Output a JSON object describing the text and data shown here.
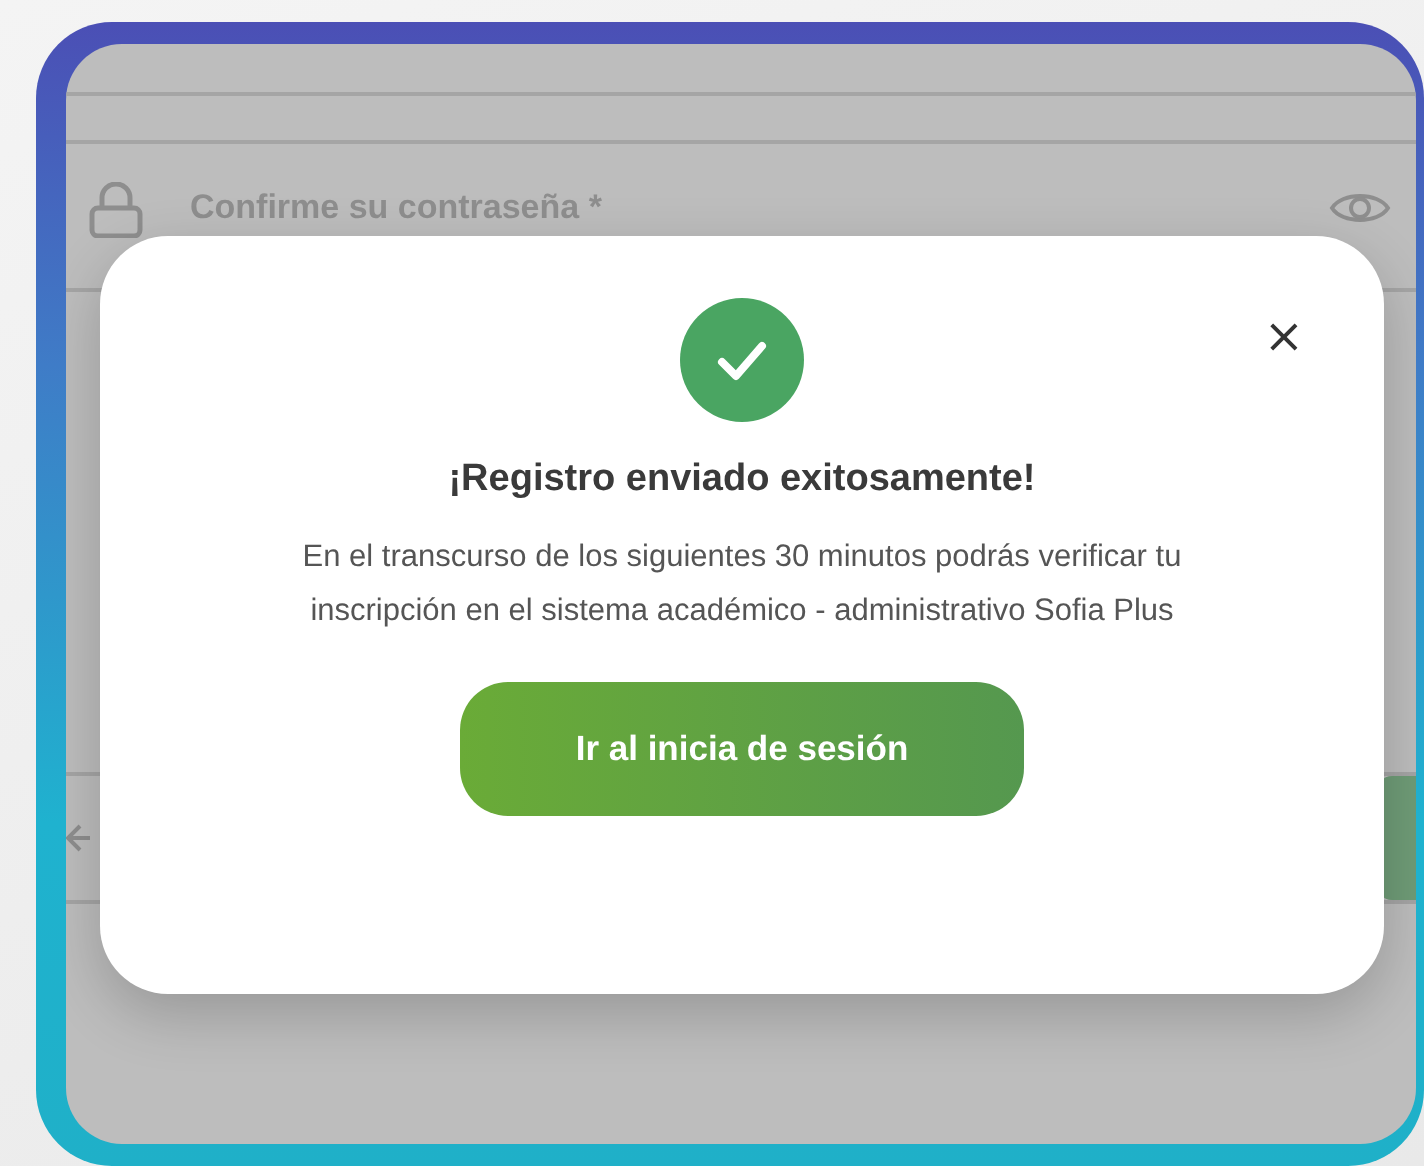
{
  "form": {
    "confirm_password": {
      "placeholder": "Confirme su contraseña *"
    }
  },
  "dialog": {
    "close": "×",
    "title": "¡Registro enviado exitosamente!",
    "message": "En el transcurso de los siguientes 30 minutos podrás verificar tu inscripción en el sistema académico - administrativo Sofia Plus",
    "button": "Ir al inicia de sesión"
  }
}
